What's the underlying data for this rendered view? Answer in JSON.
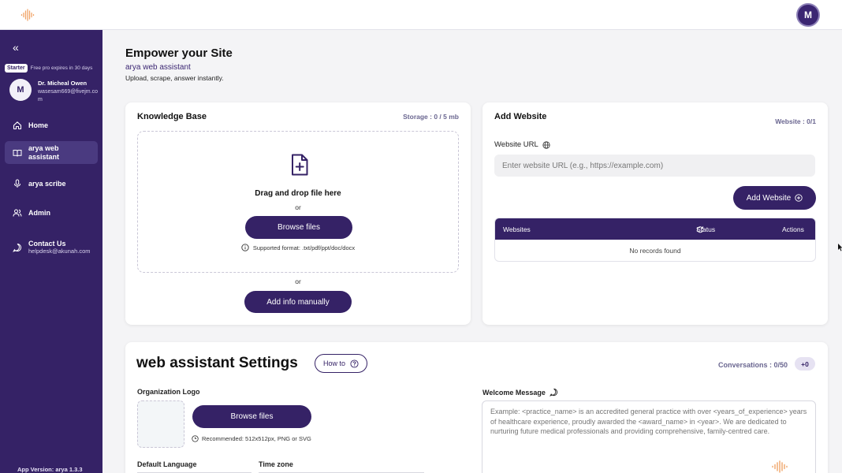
{
  "header": {
    "avatar_initial": "M"
  },
  "sidebar": {
    "plan_badge": "Starter",
    "plan_text": "Free pro expires in 30 days",
    "user": {
      "initial": "M",
      "name": "Dr. Micheal Owen",
      "email": "wasesam669@fivejm.com"
    },
    "nav": [
      {
        "label": "Home",
        "icon": "home-icon"
      },
      {
        "label": "arya web assistant",
        "icon": "book-icon",
        "active": true
      },
      {
        "label": "arya scribe",
        "icon": "mic-icon"
      },
      {
        "label": "Admin",
        "icon": "users-icon"
      },
      {
        "label": "Contact Us",
        "sub": "helpdesk@akunah.com",
        "icon": "chat-icon"
      }
    ],
    "app_version": "App Version: arya 1.3.3"
  },
  "page": {
    "title": "Empower your Site",
    "subtitle": "arya web assistant",
    "tagline": "Upload, scrape, answer instantly."
  },
  "knowledge_base": {
    "title": "Knowledge Base",
    "storage": "Storage : 0 / 5 mb",
    "drop_text": "Drag and drop file here",
    "or_1": "or",
    "browse_label": "Browse files",
    "supported": "Supported format: .txt/pdf/ppt/doc/docx",
    "or_2": "or",
    "add_manual_label": "Add info manually"
  },
  "add_website": {
    "title": "Add Website",
    "count": "Website : 0/1",
    "url_label": "Website URL",
    "url_placeholder": "Enter website URL (e.g., https://example.com)",
    "add_button": "Add Website",
    "table": {
      "columns": [
        "Websites",
        "Status",
        "Actions"
      ],
      "empty_text": "No records found"
    }
  },
  "settings": {
    "title": "web assistant Settings",
    "howto_label": "How to",
    "conversations": "Conversations : 0/50",
    "plus_badge": "+0",
    "org_logo_label": "Organization Logo",
    "browse_label": "Browse files",
    "recommended": "Recommended: 512x512px, PNG or SVG",
    "welcome_label": "Welcome Message",
    "welcome_placeholder": "Example: <practice_name> is an accredited general practice with over <years_of_experience> years of healthcare experience, proudly awarded the <award_name> in <year>. We are dedicated to nurturing future medical professionals and providing comprehensive, family-centred care.",
    "default_language_label": "Default Language",
    "timezone_label": "Time zone"
  },
  "colors": {
    "brand": "#352266",
    "accent_light": "#e6e2f2",
    "logo": "#f0a56a"
  }
}
